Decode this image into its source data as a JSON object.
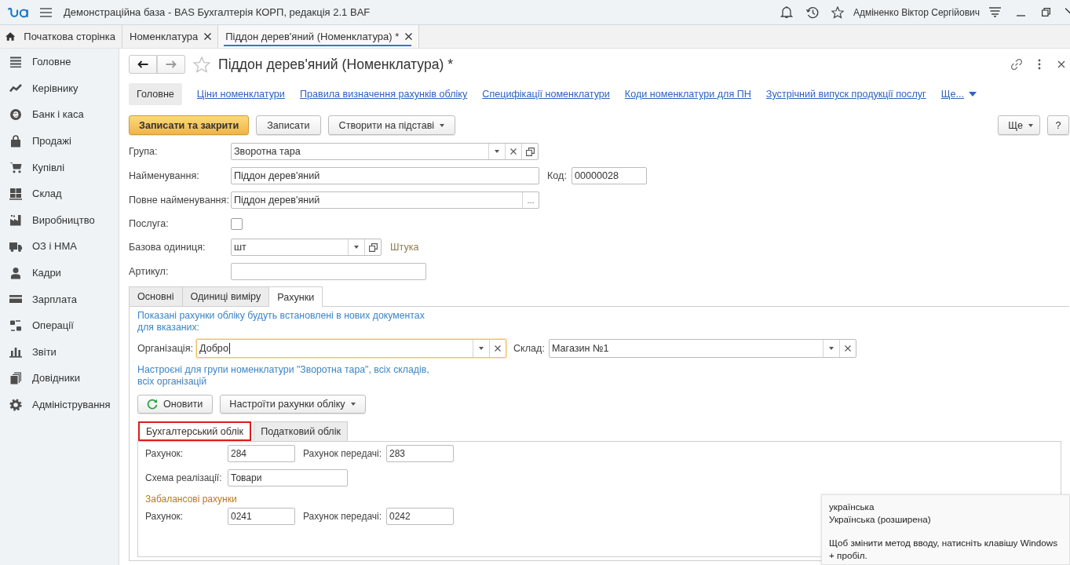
{
  "window": {
    "title": "Демонстраційна база - BAS Бухгалтерія КОРП, редакція 2.1 BAF",
    "user": "Адміненко Віктор Сергійович"
  },
  "open_tabs": [
    {
      "label": "Початкова сторінка",
      "kind": "home",
      "selected": false
    },
    {
      "label": "Номенклатура",
      "kind": "document",
      "selected": false
    },
    {
      "label": "Піддон дерев'яний (Номенклатура) *",
      "kind": "document",
      "selected": true
    }
  ],
  "sidebar": {
    "items": [
      {
        "label": "Головне"
      },
      {
        "label": "Керівнику"
      },
      {
        "label": "Банк і каса"
      },
      {
        "label": "Продажі"
      },
      {
        "label": "Купівлі"
      },
      {
        "label": "Склад"
      },
      {
        "label": "Виробництво"
      },
      {
        "label": "ОЗ і НМА"
      },
      {
        "label": "Кадри"
      },
      {
        "label": "Зарплата"
      },
      {
        "label": "Операції"
      },
      {
        "label": "Звіти"
      },
      {
        "label": "Довідники"
      },
      {
        "label": "Адміністрування"
      }
    ]
  },
  "form": {
    "title": "Піддон дерев'яний (Номенклатура) *",
    "favorite": false,
    "nav_links": [
      {
        "label": "Головне",
        "kind": "link",
        "selected": true
      },
      {
        "label": "Ціни номенклатури",
        "kind": "link",
        "selected": false
      },
      {
        "label": "Правила визначення рахунків обліку",
        "kind": "link",
        "selected": false
      },
      {
        "label": "Специфікації номенклатури",
        "kind": "link",
        "selected": false
      },
      {
        "label": "Коди номенклатури для ПН",
        "kind": "link",
        "selected": false
      },
      {
        "label": "Зустрічний випуск продукції послуг",
        "kind": "link",
        "selected": false
      },
      {
        "label": "Ще...",
        "kind": "more",
        "selected": false
      }
    ],
    "commands": [
      {
        "label": "Записати та закрити",
        "kind": "primary"
      },
      {
        "label": "Записати",
        "kind": "plain"
      },
      {
        "label": "Створити на підставі",
        "kind": "dropdown"
      }
    ],
    "side_commands": [
      {
        "label": "Ще",
        "kind": "dropdown"
      },
      {
        "label": "?",
        "kind": "plain"
      }
    ],
    "fields": [
      {
        "label": "Група:",
        "kind": "select",
        "value": "Зворотна тара"
      },
      {
        "label": "Найменування:",
        "kind": "text",
        "value": "Піддон дерев'яний",
        "code": {
          "label": "Код:",
          "value": "00000028"
        }
      },
      {
        "label": "Повне найменування:",
        "kind": "choice",
        "value": "Піддон дерев'яний",
        "button": "..."
      },
      {
        "label": "Послуга:",
        "kind": "checkbox",
        "checked": false
      },
      {
        "label": "Базова одиниця:",
        "kind": "unit",
        "value": "шт",
        "note": "Штука"
      },
      {
        "label": "Артикул:",
        "kind": "text"
      }
    ],
    "section_tabs": [
      {
        "label": "Основні",
        "selected": false
      },
      {
        "label": "Одиниці виміру",
        "selected": false
      },
      {
        "label": "Рахунки",
        "selected": true
      }
    ],
    "accounts": {
      "hint": "Показані рахунки обліку будуть встановлені в нових документах для вказаних:",
      "organization": {
        "label": "Організація:",
        "value": "Добро",
        "focused": true
      },
      "warehouse": {
        "label": "Склад:",
        "value": "Магазин №1",
        "focused": false
      },
      "note": "Настроєні для групи номенклатури \"Зворотна тара\", всіх складів, всіх організацій",
      "buttons": [
        {
          "label": "Оновити",
          "kind": "refresh"
        },
        {
          "label": "Настроїти рахунки обліку",
          "kind": "dropdown"
        }
      ],
      "subtabs": [
        {
          "label": "Бухгалтерський облік",
          "selected": true,
          "highlighted": true
        },
        {
          "label": "Податковий облік",
          "selected": false,
          "highlighted": false
        }
      ],
      "rows": [
        {
          "kind": "pair",
          "fields": [
            {
              "label": "Рахунок:",
              "value": "284"
            },
            {
              "label": "Рахунок передачі:",
              "value": "283"
            }
          ]
        },
        {
          "kind": "wide",
          "fields": [
            {
              "label": "Схема реалізації:",
              "value": "Товари"
            }
          ]
        },
        {
          "kind": "heading",
          "label": "Забалансові рахунки"
        },
        {
          "kind": "pair",
          "fields": [
            {
              "label": "Рахунок:",
              "value": "0241"
            },
            {
              "label": "Рахунок передачі:",
              "value": "0242"
            }
          ]
        }
      ]
    }
  },
  "ime_popup": {
    "languages": [
      "українська",
      "Українська (розширена)"
    ],
    "hint": "Щоб змінити метод вводу, натисніть клавішу Windows + пробіл."
  }
}
